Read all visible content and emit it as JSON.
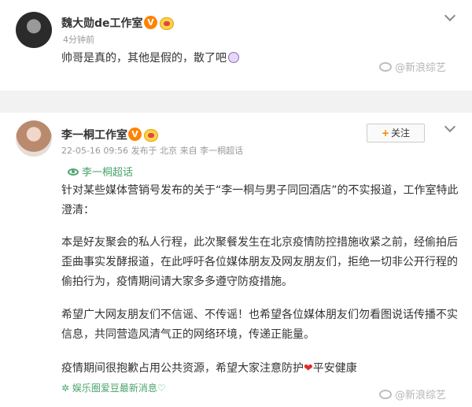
{
  "post1": {
    "author": "魏大勋de工作室",
    "verified": "V",
    "time": "4分钟前",
    "content": "帅哥是真的，其他是假的，散了吧",
    "watermark": "@新浪综艺"
  },
  "post2": {
    "author": "李一桐工作室",
    "verified": "V",
    "meta": "22-05-16 09:56  发布于 北京  来自 李一桐超话",
    "follow_plus": "+",
    "follow_label": "关注",
    "super_topic": "李一桐超话",
    "paragraphs": [
      "针对某些媒体营销号发布的关于“李一桐与男子同回酒店”的不实报道，工作室特此澄清：",
      "本是好友聚会的私人行程，此次聚餐发生在北京疫情防控措施收紧之前，经偷拍后歪曲事实发酵报道，在此呼吁各位媒体朋友及网友朋友们，拒绝一切非公开行程的偷拍行为，疫情期间请大家多多遵守防疫措施。",
      "希望广大网友朋友们不信谣、不传谣！也希望各位媒体朋友们勿看图说话传播不实信息，共同营造风清气正的网络环境，传递正能量。"
    ],
    "closing_before": "疫情期间很抱歉占用公共资源，希望大家注意防护",
    "closing_heart": "❤",
    "closing_after": "平安健康",
    "source": "✲ 娱乐圈爱豆最新消息♡",
    "watermark": "@新浪综艺"
  },
  "colors": {
    "verified_badge": "#ff8200",
    "link_green": "#4aa36b",
    "heart_red": "#e02b2b",
    "gap_gray": "#f2f2f2"
  },
  "icons": [
    "avatar",
    "verified-v-icon",
    "medal-icon",
    "chevron-down-icon",
    "eye-icon",
    "weibo-logo-icon",
    "face-emoji-icon"
  ]
}
